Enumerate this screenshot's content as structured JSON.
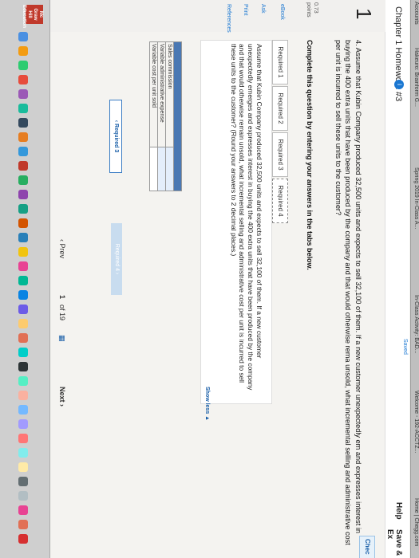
{
  "browser": {
    "tabs": [
      "Accounts",
      "Hakeuro: Brainform G...",
      "Spring 2019 In-Class A...",
      "In-Class Activity: BAD...",
      "Welcome - 192-ACCTZ...",
      "Home | Chegg.com"
    ]
  },
  "header": {
    "title": "Chapter 1 Homework #3",
    "info_icon_text": "i",
    "saved_label": "Saved",
    "help_label": "Help",
    "save_exit_label": "Save & Ex"
  },
  "question": {
    "number": "1",
    "points_value": "0.73",
    "points_label": "points",
    "check_label": "Chec",
    "text": "4. Assume that Kubin Company produced 32,500 units and expects to sell 32,100 of them. If a new customer unexpectedly em and expresses interest in buying the 400 extra units that have been produced by the company and that would otherwise rema unsold, what incremental selling and administrative cost per unit is incurred to sell these units to the customer?",
    "instruction": "Complete this question by entering your answers in the tabs below."
  },
  "sidebar": {
    "links": [
      "eBook",
      "Ask",
      "Print",
      "References"
    ]
  },
  "answer_tabs": [
    "Required 1",
    "Required 2",
    "Required 3",
    "Required 4"
  ],
  "panel": {
    "text": "Assume that Kubin Company produced 32,500 units and expects to sell 32,100 of them. If a new customer unexpectedly emerges and expresses interest in buying the 400 extra units that have been produced by the company and that would otherwise remain unsold, what incremental selling and administrative cost per unit is incurred to sell these units to the customer? (Round your answers to 2 decimal places.)",
    "show_less": "Show less ▲"
  },
  "answer_table": {
    "rows": [
      "Sales commission",
      "Variable administrative expense",
      "Variable cost per unit sold"
    ]
  },
  "navigation": {
    "prev_required": "‹  Required 3",
    "next_required": "Required 4  ›"
  },
  "pager": {
    "prev": "‹  Prev",
    "page": "1",
    "of": "of 19",
    "next": "Next  ›"
  },
  "dock": {
    "brand": "Mc Graw Hill Education"
  }
}
